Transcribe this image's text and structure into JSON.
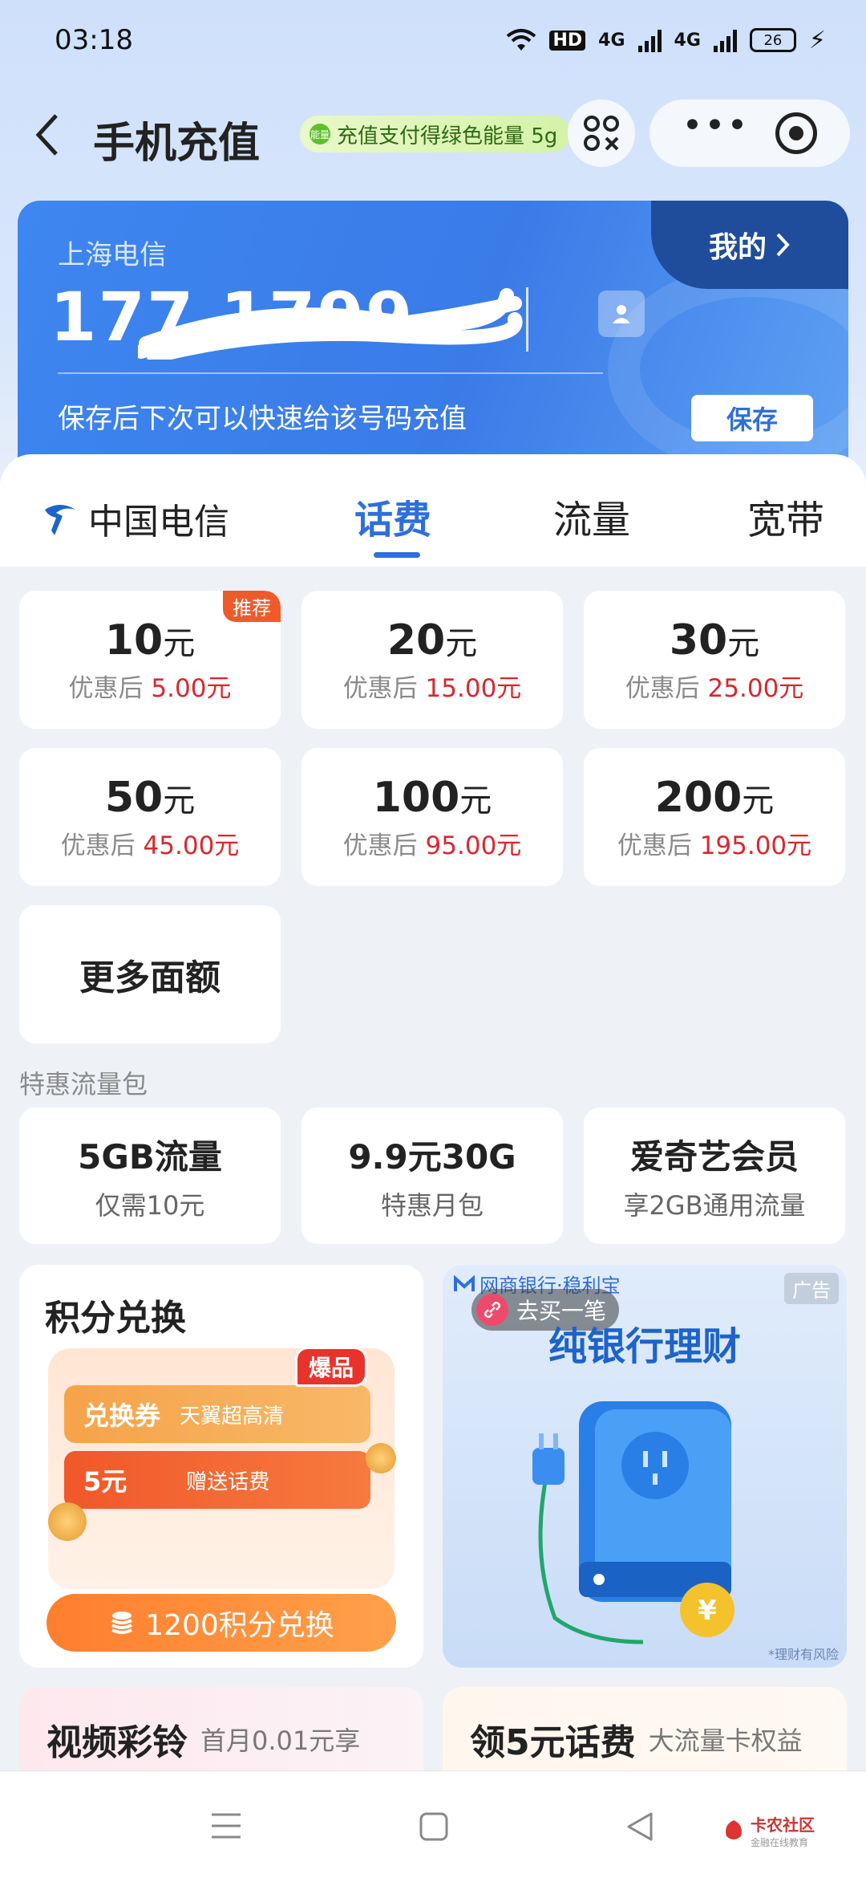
{
  "status_bar": {
    "time": "03:18",
    "hd_label": "HD",
    "net1": "4G",
    "net2": "4G",
    "battery": "26"
  },
  "header": {
    "back_icon": "chevron-left-icon",
    "title": "手机充值",
    "promo_text": "充值支付得绿色能量 5g",
    "promo_badge": "能量"
  },
  "account": {
    "carrier": "上海电信",
    "phone": "177 1799 7036",
    "mine_label": "我的",
    "hint": "保存后下次可以快速给该号码充值",
    "save_label": "保存"
  },
  "tabs": {
    "brand": "中国电信",
    "items": [
      "话费",
      "流量",
      "宽带"
    ],
    "active": "话费"
  },
  "recharge": {
    "unit": "元",
    "prefix": "优惠后",
    "badge": "推荐",
    "options": [
      {
        "amount": "10",
        "price": "5.00元"
      },
      {
        "amount": "20",
        "price": "15.00元"
      },
      {
        "amount": "30",
        "price": "25.00元"
      },
      {
        "amount": "50",
        "price": "45.00元"
      },
      {
        "amount": "100",
        "price": "95.00元"
      },
      {
        "amount": "200",
        "price": "195.00元"
      }
    ],
    "more_label": "更多面额"
  },
  "packages": {
    "section_title": "特惠流量包",
    "items": [
      {
        "title": "5GB流量",
        "sub": "仅需10元"
      },
      {
        "title": "9.9元30G",
        "sub": "特惠月包"
      },
      {
        "title": "爱奇艺会员",
        "sub": "享2GB通用流量"
      }
    ]
  },
  "points": {
    "title": "积分兑换",
    "hot": "爆品",
    "coupon1_big": "兑换券",
    "coupon1_small": "天翼超高清",
    "coupon2_big": "5元",
    "coupon2_small": "赠送话费",
    "button": "1200积分兑换"
  },
  "ad": {
    "tag": "广告",
    "bank": "网商银行·稳利宝",
    "link": "去买一笔",
    "title": "纯银行理财",
    "risk": "*理财有风险"
  },
  "bottom_cards": [
    {
      "title": "视频彩铃",
      "sub": "首月0.01元享"
    },
    {
      "title": "领5元话费",
      "sub": "大流量卡权益"
    }
  ],
  "watermark": {
    "line1": "卡农社区",
    "line2": "金融在线教育"
  },
  "colors": {
    "primary": "#2f6fd9",
    "price_red": "#d8282d",
    "card_blue": "#3a7be8"
  }
}
